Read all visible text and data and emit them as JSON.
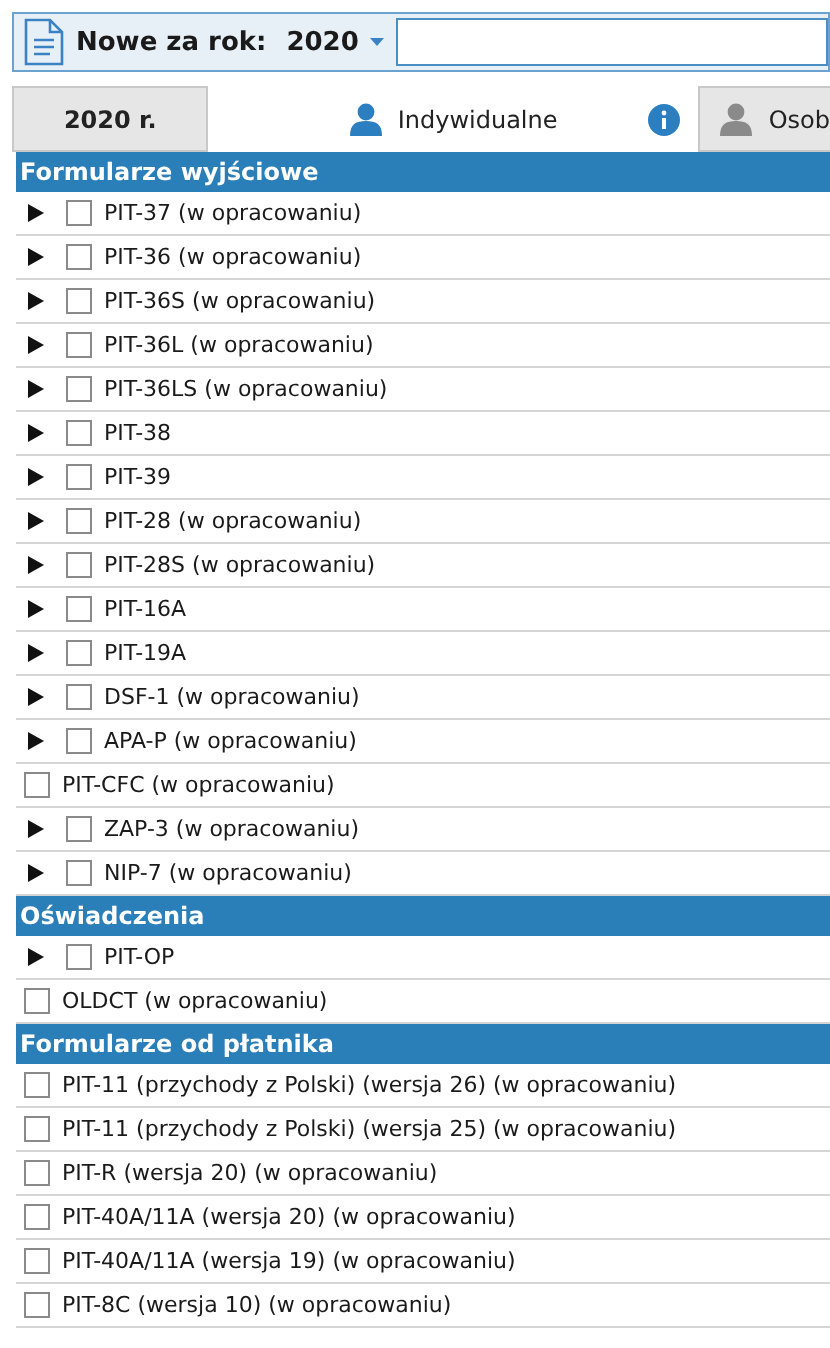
{
  "toolbar": {
    "label": "Nowe za rok:",
    "year": "2020"
  },
  "tabs": [
    {
      "label": "2020 r.",
      "kind": "year",
      "selected": false
    },
    {
      "label": "Indywidualne",
      "kind": "person",
      "selected": true,
      "info": true
    },
    {
      "label": "Osob",
      "kind": "person",
      "selected": false,
      "info": false
    }
  ],
  "sections": [
    {
      "title": "Formularze wyjściowe",
      "items": [
        {
          "label": "PIT-37 (w opracowaniu)",
          "kind": "expandable",
          "checked": false
        },
        {
          "label": "PIT-36 (w opracowaniu)",
          "kind": "expandable",
          "checked": false
        },
        {
          "label": "PIT-36S (w opracowaniu)",
          "kind": "expandable",
          "checked": false
        },
        {
          "label": "PIT-36L (w opracowaniu)",
          "kind": "expandable",
          "checked": false
        },
        {
          "label": "PIT-36LS (w opracowaniu)",
          "kind": "expandable",
          "checked": false
        },
        {
          "label": "PIT-38",
          "kind": "expandable",
          "checked": false
        },
        {
          "label": "PIT-39",
          "kind": "expandable",
          "checked": false
        },
        {
          "label": "PIT-28 (w opracowaniu)",
          "kind": "expandable",
          "checked": false
        },
        {
          "label": "PIT-28S (w opracowaniu)",
          "kind": "expandable",
          "checked": false
        },
        {
          "label": "PIT-16A",
          "kind": "expandable",
          "checked": false
        },
        {
          "label": "PIT-19A",
          "kind": "expandable",
          "checked": false
        },
        {
          "label": "DSF-1 (w opracowaniu)",
          "kind": "expandable",
          "checked": false
        },
        {
          "label": "APA-P (w opracowaniu)",
          "kind": "expandable",
          "checked": false
        },
        {
          "label": "PIT-CFC (w opracowaniu)",
          "kind": "plain",
          "checked": false
        },
        {
          "label": "ZAP-3 (w opracowaniu)",
          "kind": "expandable",
          "checked": false
        },
        {
          "label": "NIP-7 (w opracowaniu)",
          "kind": "expandable",
          "checked": false
        }
      ]
    },
    {
      "title": "Oświadczenia",
      "items": [
        {
          "label": "PIT-OP",
          "kind": "expandable",
          "checked": false
        },
        {
          "label": "OLDCT (w opracowaniu)",
          "kind": "plain",
          "checked": false
        }
      ]
    },
    {
      "title": "Formularze od płatnika",
      "items": [
        {
          "label": "PIT-11 (przychody z Polski) (wersja 26) (w opracowaniu)",
          "kind": "plain",
          "checked": false
        },
        {
          "label": "PIT-11 (przychody z Polski) (wersja 25) (w opracowaniu)",
          "kind": "plain",
          "checked": false
        },
        {
          "label": "PIT-R (wersja 20) (w opracowaniu)",
          "kind": "plain",
          "checked": false
        },
        {
          "label": "PIT-40A/11A (wersja 20) (w opracowaniu)",
          "kind": "plain",
          "checked": false
        },
        {
          "label": "PIT-40A/11A (wersja 19) (w opracowaniu)",
          "kind": "plain",
          "checked": false
        },
        {
          "label": "PIT-8C (wersja 10) (w opracowaniu)",
          "kind": "plain",
          "checked": false
        }
      ]
    }
  ]
}
